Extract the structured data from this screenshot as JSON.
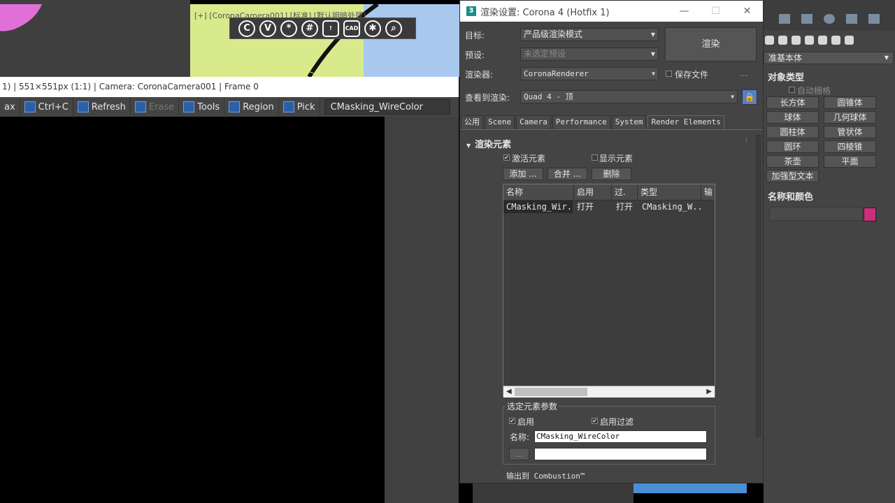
{
  "viewport": {
    "label": "[+] [CoronaCamera001] [标准] [默认明暗处理]",
    "corona_toolbar": [
      "C",
      "V",
      "*",
      "#",
      "!",
      "CAD",
      "✱",
      "⌕"
    ]
  },
  "vfb": {
    "status": "1) | 551×551px (1:1) | Camera: CoronaCamera001 | Frame 0",
    "toolbar": {
      "max_label": "ax",
      "copy_label": "Ctrl+C",
      "refresh_label": "Refresh",
      "erase_label": "Erase",
      "tools_label": "Tools",
      "region_label": "Region",
      "pick_label": "Pick",
      "channel_value": "CMasking_WireColor"
    }
  },
  "dialog": {
    "title": "渲染设置: Corona 4 (Hotfix 1)",
    "target_label": "目标:",
    "target_value": "产品级渲染模式",
    "preset_label": "预设:",
    "preset_value": "未选定预设",
    "renderer_label": "渲染器:",
    "renderer_value": "CoronaRenderer",
    "save_file_label": "保存文件",
    "more_label": "...",
    "view_label": "查看到渲染:",
    "view_value": "Quad 4 - 顶",
    "render_button": "渲染",
    "tabs": [
      "公用",
      "Scene",
      "Camera",
      "Performance",
      "System",
      "Render Elements"
    ],
    "active_tab": "Render Elements",
    "rollout_title": "渲染元素",
    "active_elements_label": "激活元素",
    "display_elements_label": "显示元素",
    "add_button": "添加 ...",
    "merge_button": "合并 ...",
    "delete_button": "删除",
    "list_columns": [
      "名称",
      "启用",
      "过.",
      "类型",
      "输"
    ],
    "list_rows": [
      {
        "name": "CMasking_Wir...",
        "enabled": "打开",
        "filter": "打开",
        "type": "CMasking_W..."
      }
    ],
    "selected_params_title": "选定元素参数",
    "enable_label": "启用",
    "enable_filter_label": "启用过滤",
    "name_label": "名称:",
    "name_value": "CMasking_WireColor",
    "browse_button": "...",
    "path_value": "",
    "combustion_label": "输出到 Combustion™"
  },
  "command_panel": {
    "category": "准基本体",
    "object_type_title": "对象类型",
    "autogrid_label": "自动栅格",
    "objects": [
      "长方体",
      "圆锥体",
      "球体",
      "几何球体",
      "圆柱体",
      "管状体",
      "圆环",
      "四棱锥",
      "茶壶",
      "平面"
    ],
    "extra_object": "加强型文本",
    "name_color_title": "名称和颜色",
    "object_color": "#c8307a"
  },
  "colors": {
    "accent_blue": "#5a7dc6",
    "viewport_green": "#d8ea8c",
    "viewport_blue": "#a9c8ee"
  }
}
